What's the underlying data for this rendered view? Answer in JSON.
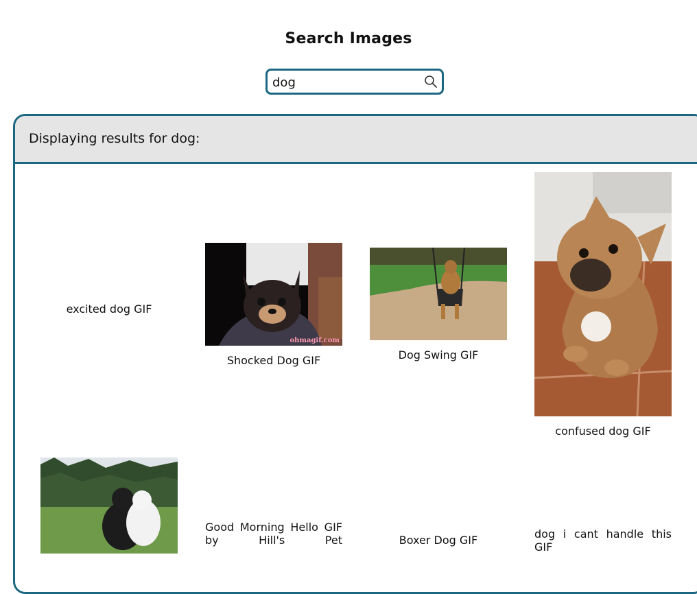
{
  "page": {
    "title": "Search Images"
  },
  "search": {
    "value": "dog",
    "icon": "search-icon"
  },
  "results": {
    "header": "Displaying results for dog:",
    "items": [
      {
        "caption": "excited dog GIF",
        "image": "none"
      },
      {
        "caption": "Shocked Dog GIF",
        "image": "chihuahua",
        "watermark": "ohmagif.com"
      },
      {
        "caption": "Dog Swing GIF",
        "image": "dog-on-swing"
      },
      {
        "caption": "confused dog GIF",
        "image": "french-bulldog"
      },
      {
        "caption": "",
        "image": "two-dogs-on-grass"
      },
      {
        "caption": "Good Morning Hello GIF by Hill's Pet",
        "image": "none"
      },
      {
        "caption": "Boxer Dog GIF",
        "image": "none"
      },
      {
        "caption": "dog i cant handle this GIF",
        "image": "none"
      }
    ]
  },
  "colors": {
    "accent": "#1b6680",
    "header_bg": "#e6e5e6"
  }
}
